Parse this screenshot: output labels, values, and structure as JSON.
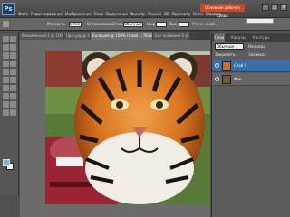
{
  "app": {
    "logo": "Ps"
  },
  "menu": [
    "Файл",
    "Редактирование",
    "Изображение",
    "Слои",
    "Выделение",
    "Фильтр",
    "Анализ",
    "3D",
    "Просмотр",
    "Окно",
    "Справка"
  ],
  "workspace_button": "Основная рабочая среда",
  "options": {
    "tolerance_label": "Мягкость",
    "tolerance_value": "0 пкс",
    "antialias_label": "Сглаживание",
    "style_label": "Стиль",
    "style_value": "Обычный",
    "width_label": "Шир.",
    "height_label": "Выс.",
    "refine_label": "Уточн. край..."
  },
  "tabs": [
    {
      "label": "Безымянный-1 @ 100% (Слой 1, RGB/8)",
      "active": false
    },
    {
      "label": "tiger.jpg @ 100% (RGB/8)",
      "active": false
    },
    {
      "label": "Большой @ 100% (Слой 1, RGB/8) *",
      "active": true
    },
    {
      "label": "Без названия-2 @ 100%",
      "active": false
    }
  ],
  "panel": {
    "tabs": [
      "Слои",
      "Каналы",
      "Контуры"
    ],
    "active_tab": "Слои",
    "blend_mode": "Обычные",
    "opacity_label": "Непрозр.:",
    "lock_label": "Закрепить:",
    "fill_label": "Заливка:",
    "layers": [
      {
        "name": "Слой 1",
        "active": true
      },
      {
        "name": "Фон",
        "active": false
      }
    ]
  },
  "colors": {
    "foreground": "#7ab3cf",
    "background": "#ffffff",
    "workspace_accent": "#c94a2a",
    "layer_selected": "#3a6ea8"
  },
  "icons": [
    "move-tool-icon",
    "marquee-tool-icon",
    "lasso-tool-icon",
    "quick-selection-tool-icon",
    "crop-tool-icon",
    "eyedropper-tool-icon",
    "healing-brush-tool-icon",
    "brush-tool-icon",
    "clone-stamp-tool-icon",
    "history-brush-tool-icon",
    "eraser-tool-icon",
    "gradient-tool-icon",
    "blur-tool-icon",
    "dodge-tool-icon",
    "pen-tool-icon",
    "type-tool-icon",
    "path-selection-tool-icon",
    "shape-tool-icon",
    "hand-tool-icon",
    "zoom-tool-icon"
  ]
}
